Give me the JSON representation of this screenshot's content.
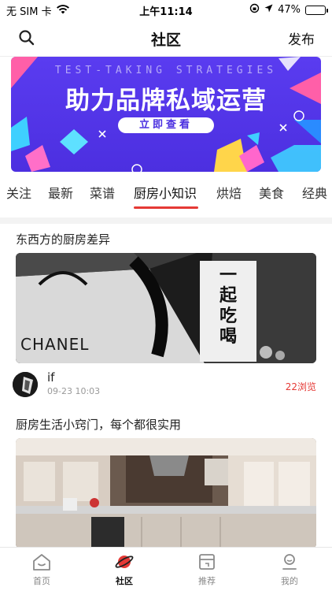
{
  "status_bar": {
    "carrier": "无 SIM 卡",
    "time": "上午11:14",
    "battery": "47%",
    "battery_level": 0.47
  },
  "nav": {
    "title": "社区",
    "publish_label": "发布",
    "search_icon": "search-icon"
  },
  "banner": {
    "subtitle": "TEST-TAKING STRATEGIES",
    "title": "助力品牌私域运营",
    "button_label": "立即查看"
  },
  "tabs": [
    {
      "label": "关注"
    },
    {
      "label": "最新"
    },
    {
      "label": "菜谱"
    },
    {
      "label": "厨房小知识"
    },
    {
      "label": "烘焙"
    },
    {
      "label": "美食"
    },
    {
      "label": "经典"
    }
  ],
  "active_tab": "厨房小知识",
  "posts": [
    {
      "title": "东西方的厨房差异",
      "image_text": {
        "brand": "CHANEL",
        "vertical": "一起吃喝"
      },
      "author": "if",
      "date": "09-23 10:03",
      "views": "22浏览"
    },
    {
      "title": "厨房生活小窍门，每个都很实用"
    }
  ],
  "tabbar": [
    {
      "label": "首页",
      "icon": "home-icon"
    },
    {
      "label": "社区",
      "icon": "planet-icon"
    },
    {
      "label": "推荐",
      "icon": "recommend-icon"
    },
    {
      "label": "我的",
      "icon": "profile-icon"
    }
  ],
  "colors": {
    "accent": "#e53935",
    "banner_bg": "#4c2fe0"
  }
}
